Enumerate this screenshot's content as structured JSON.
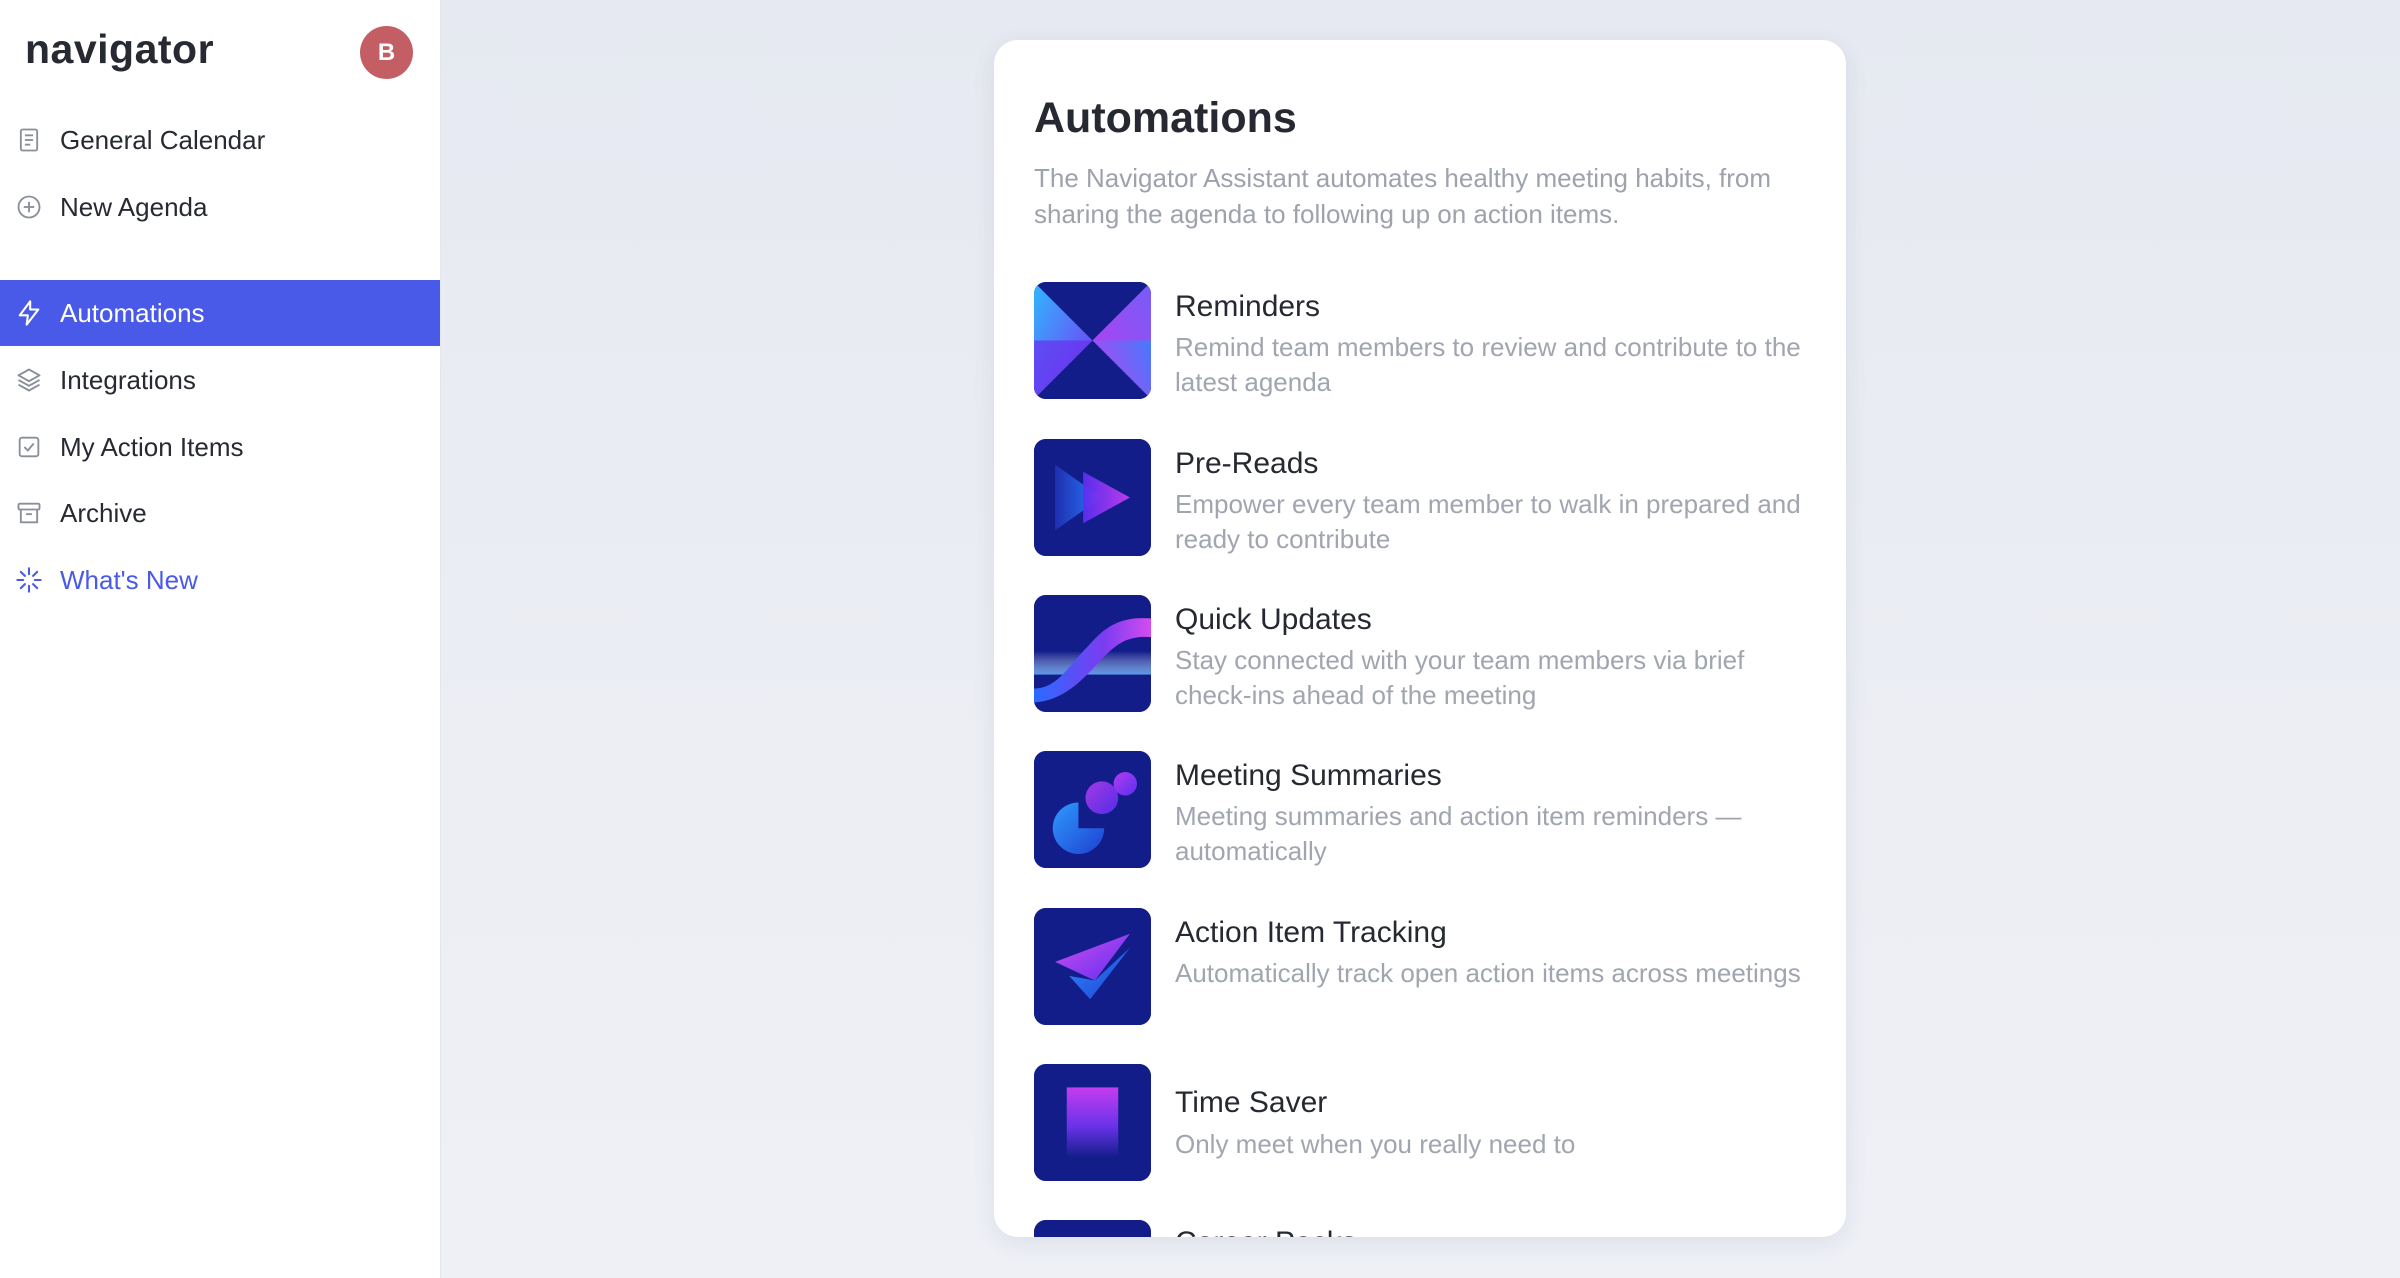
{
  "app": {
    "logo": "navigator",
    "user_initial": "B",
    "avatar_color": "#c25e64"
  },
  "colors": {
    "accent": "#4a5ae8",
    "icon_tile": "#121d8a"
  },
  "sidebar": {
    "items": [
      {
        "label": "General Calendar",
        "icon": "document-icon"
      },
      {
        "label": "New Agenda",
        "icon": "plus-circle-icon"
      },
      {
        "label": "Automations",
        "icon": "lightning-icon",
        "active": true
      },
      {
        "label": "Integrations",
        "icon": "layers-icon"
      },
      {
        "label": "My Action Items",
        "icon": "checkbox-icon"
      },
      {
        "label": "Archive",
        "icon": "archive-icon"
      },
      {
        "label": "What's New",
        "icon": "sparkle-icon",
        "highlight": true
      }
    ]
  },
  "main": {
    "title": "Automations",
    "subtitle": "The Navigator Assistant automates healthy meeting habits, from sharing the agenda to following up on action items.",
    "items": [
      {
        "name": "Reminders",
        "description": "Remind team members to review and contribute to the latest agenda",
        "icon": "reminders-icon"
      },
      {
        "name": "Pre-Reads",
        "description": "Empower every team member to walk in prepared and ready to contribute",
        "icon": "pre-reads-icon"
      },
      {
        "name": "Quick Updates",
        "description": "Stay connected with your team members via brief check-ins ahead of the meeting",
        "icon": "quick-updates-icon"
      },
      {
        "name": "Meeting Summaries",
        "description": "Meeting summaries and action item reminders — automatically",
        "icon": "meeting-summaries-icon"
      },
      {
        "name": "Action Item Tracking",
        "description": "Automatically track open action items across meetings",
        "icon": "action-tracking-icon"
      },
      {
        "name": "Time Saver",
        "description": "Only meet when you really need to",
        "icon": "time-saver-icon"
      },
      {
        "name": "Career Packs",
        "description": "",
        "icon": "career-packs-icon"
      }
    ]
  }
}
